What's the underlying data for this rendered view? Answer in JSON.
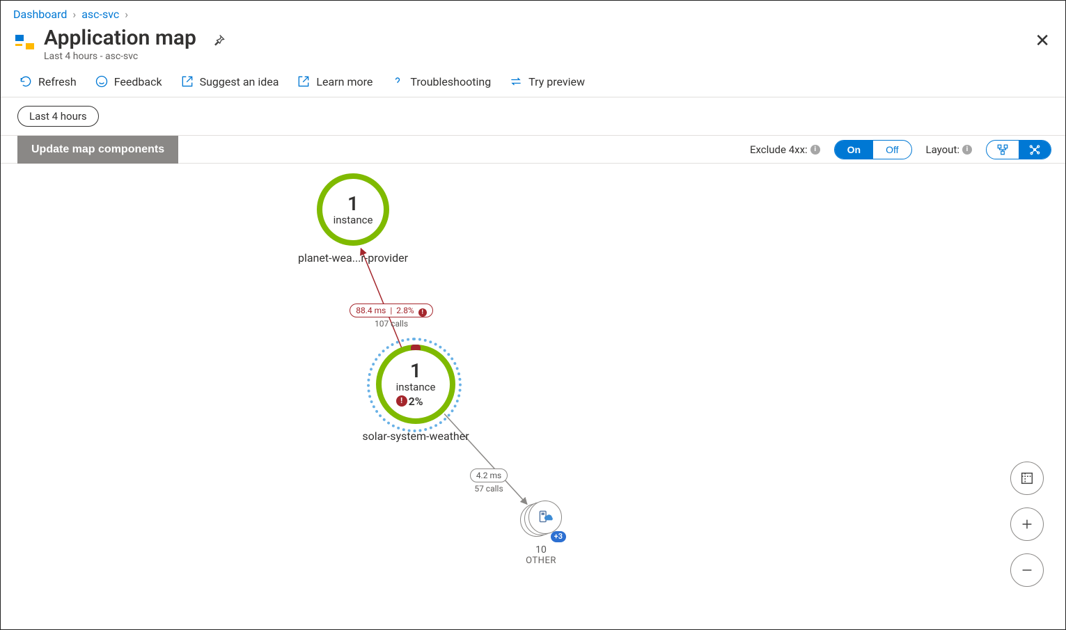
{
  "breadcrumb": {
    "dashboard": "Dashboard",
    "resource": "asc-svc"
  },
  "header": {
    "title": "Application map",
    "subtitle": "Last 4 hours - asc-svc"
  },
  "toolbar": {
    "refresh": "Refresh",
    "feedback": "Feedback",
    "suggest": "Suggest an idea",
    "learn": "Learn more",
    "troubleshoot": "Troubleshooting",
    "preview": "Try preview"
  },
  "timerange": {
    "label": "Last 4 hours"
  },
  "controls": {
    "update": "Update map components",
    "exclude4xx_label": "Exclude 4xx:",
    "seg_on": "On",
    "seg_off": "Off",
    "layout_label": "Layout:"
  },
  "nodes": {
    "planet": {
      "count": "1",
      "unit": "instance",
      "label": "planet-wea...r-provider"
    },
    "solar": {
      "count": "1",
      "unit": "instance",
      "err_pct": "2%",
      "label": "solar-system-weather"
    },
    "other": {
      "count": "10",
      "label": "OTHER",
      "badge": "+3"
    }
  },
  "edges": {
    "solar_to_planet": {
      "latency": "88.4 ms",
      "err": "2.8%",
      "calls": "107 calls"
    },
    "solar_to_other": {
      "latency": "4.2 ms",
      "calls": "57 calls"
    }
  }
}
